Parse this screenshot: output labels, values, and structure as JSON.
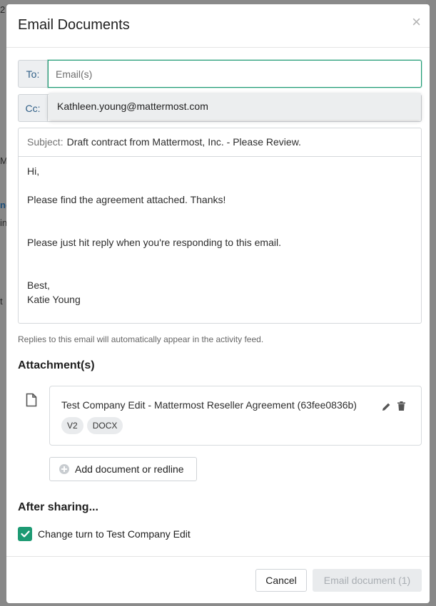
{
  "background": {
    "fragments": [
      "2",
      "M",
      "nc",
      "in",
      "t"
    ]
  },
  "modal": {
    "title": "Email Documents",
    "close_glyph": "×"
  },
  "to": {
    "label": "To:",
    "placeholder": "Email(s)",
    "value": ""
  },
  "cc": {
    "label": "Cc:"
  },
  "suggestion": {
    "email": "Kathleen.young@mattermost.com"
  },
  "subject": {
    "label": "Subject:",
    "value": "Draft contract from Mattermost, Inc. - Please Review."
  },
  "message": {
    "lines": [
      "Hi,",
      "",
      "Please find the agreement attached. Thanks!",
      "",
      "",
      "Please just hit reply when you're responding to this email.",
      "",
      "",
      "Best,",
      "Katie Young"
    ]
  },
  "hint": "Replies to this email will automatically appear in the activity feed.",
  "attachments": {
    "heading": "Attachment(s)",
    "items": [
      {
        "name": "Test Company Edit - Mattermost Reseller Agreement (63fee0836b)",
        "tags": [
          "V2",
          "DOCX"
        ]
      }
    ],
    "add_label": "Add document or redline"
  },
  "after_sharing": {
    "heading": "After sharing...",
    "checkbox_label": "Change turn to Test Company Edit",
    "checked": true
  },
  "footer": {
    "cancel_label": "Cancel",
    "send_label": "Email document (1)"
  },
  "colors": {
    "accent": "#1d9a73",
    "addon_text": "#2f5e86",
    "disabled_text": "#a8adb2"
  }
}
